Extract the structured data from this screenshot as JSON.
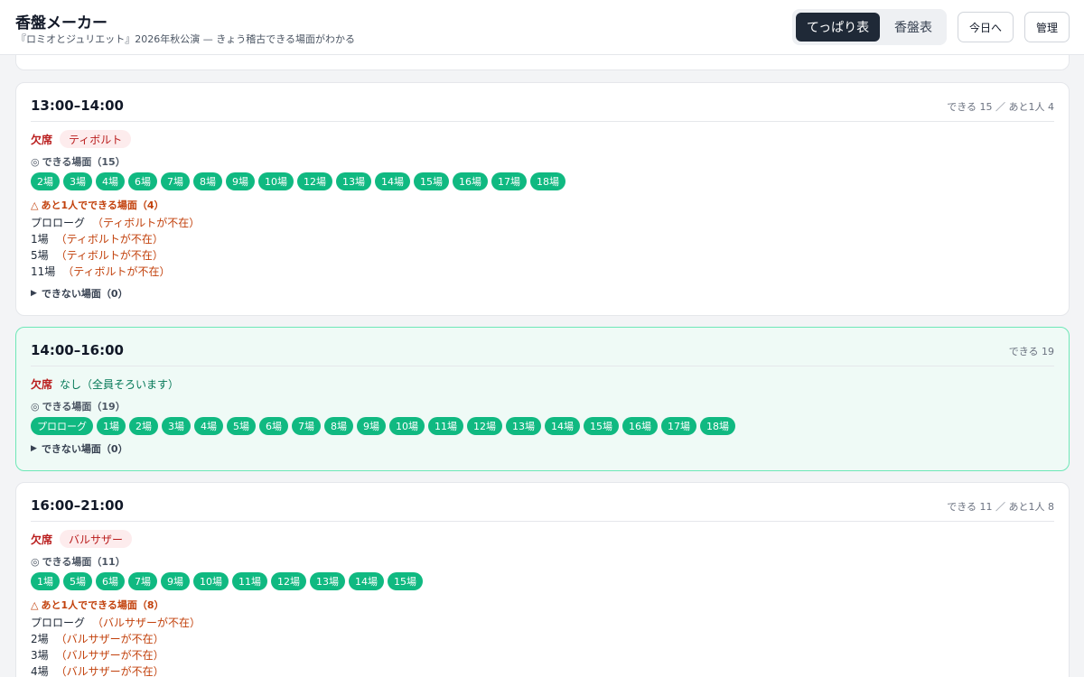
{
  "header": {
    "title": "香盤メーカー",
    "subtitle": "『ロミオとジュリエット』2026年秋公演 — きょう稽古できる場面がわかる",
    "view_tabs": [
      "てっぱり表",
      "香盤表"
    ],
    "today_button": "今日へ",
    "admin_button": "管理"
  },
  "labels": {
    "absent": "欠席",
    "can_prefix": "◎",
    "one_more_prefix": "△",
    "cannot_prefix": "▶"
  },
  "slots": [
    {
      "time": "13:00–14:00",
      "counts": "できる 15 ／ あと1人 4",
      "absent": "ティボルト",
      "can_label": "できる場面（15）",
      "can": [
        "2場",
        "3場",
        "4場",
        "6場",
        "7場",
        "8場",
        "9場",
        "10場",
        "12場",
        "13場",
        "14場",
        "15場",
        "16場",
        "17場",
        "18場"
      ],
      "one_more_label": "あと1人でできる場面（4）",
      "one_more": [
        {
          "scene": "プロローグ",
          "note": "（ティボルトが不在）"
        },
        {
          "scene": "1場",
          "note": "（ティボルトが不在）"
        },
        {
          "scene": "5場",
          "note": "（ティボルトが不在）"
        },
        {
          "scene": "11場",
          "note": "（ティボルトが不在）"
        }
      ],
      "cannot_label": "できない場面（0）"
    },
    {
      "time": "14:00–16:00",
      "counts": "できる 19",
      "absent_none": "なし（全員そろいます）",
      "can_label": "できる場面（19）",
      "can": [
        "プロローグ",
        "1場",
        "2場",
        "3場",
        "4場",
        "5場",
        "6場",
        "7場",
        "8場",
        "9場",
        "10場",
        "11場",
        "12場",
        "13場",
        "14場",
        "15場",
        "16場",
        "17場",
        "18場"
      ],
      "cannot_label": "できない場面（0）"
    },
    {
      "time": "16:00–21:00",
      "counts": "できる 11 ／ あと1人 8",
      "absent": "バルサザー",
      "can_label": "できる場面（11）",
      "can": [
        "1場",
        "5場",
        "6場",
        "7場",
        "9場",
        "10場",
        "11場",
        "12場",
        "13場",
        "14場",
        "15場"
      ],
      "one_more_label": "あと1人でできる場面（8）",
      "one_more": [
        {
          "scene": "プロローグ",
          "note": "（バルサザーが不在）"
        },
        {
          "scene": "2場",
          "note": "（バルサザーが不在）"
        },
        {
          "scene": "3場",
          "note": "（バルサザーが不在）"
        },
        {
          "scene": "4場",
          "note": "（バルサザーが不在）"
        }
      ]
    }
  ]
}
